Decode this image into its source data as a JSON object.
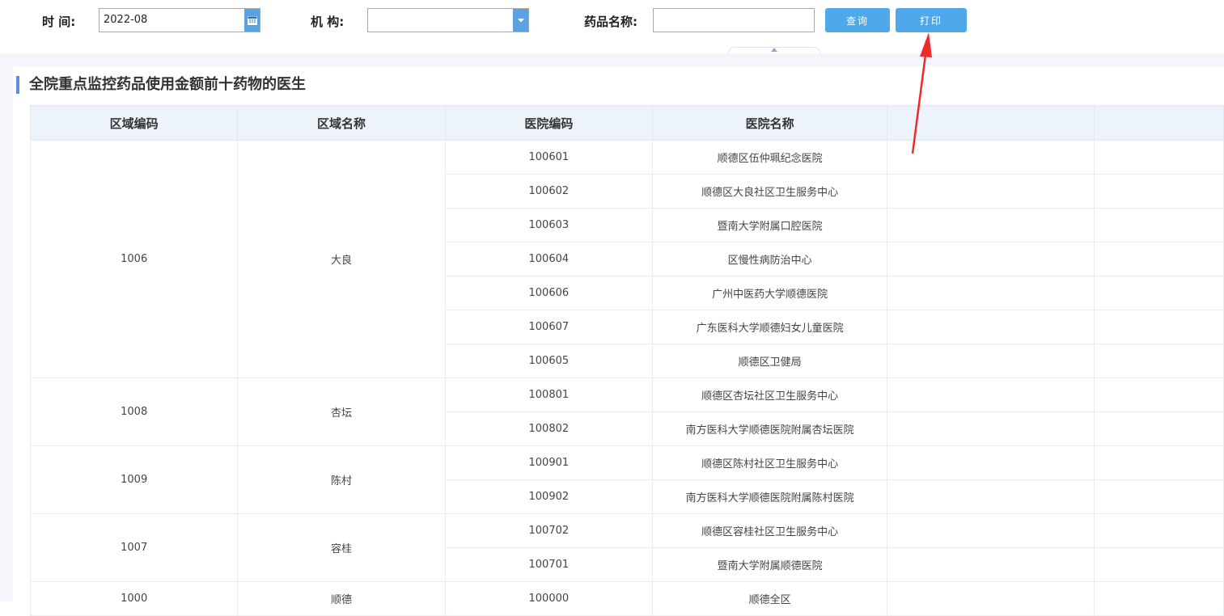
{
  "filters": {
    "time_label": "时 间:",
    "time_value": "2022-08",
    "org_label": "机 构:",
    "org_value": "",
    "drug_label": "药品名称:",
    "drug_value": "",
    "query_button": "查询",
    "print_button": "打印"
  },
  "section": {
    "title": "全院重点监控药品使用金额前十药物的医生"
  },
  "table": {
    "headers": [
      "区域编码",
      "区域名称",
      "医院编码",
      "医院名称",
      "",
      ""
    ],
    "groups": [
      {
        "area_code": "1006",
        "area_name": "大良",
        "hospitals": [
          {
            "code": "100601",
            "name": "顺德区伍仲珮纪念医院"
          },
          {
            "code": "100602",
            "name": "顺德区大良社区卫生服务中心"
          },
          {
            "code": "100603",
            "name": "暨南大学附属口腔医院"
          },
          {
            "code": "100604",
            "name": "区慢性病防治中心"
          },
          {
            "code": "100606",
            "name": "广州中医药大学顺德医院"
          },
          {
            "code": "100607",
            "name": "广东医科大学顺德妇女儿童医院"
          },
          {
            "code": "100605",
            "name": "顺德区卫健局"
          }
        ]
      },
      {
        "area_code": "1008",
        "area_name": "杏坛",
        "hospitals": [
          {
            "code": "100801",
            "name": "顺德区杏坛社区卫生服务中心"
          },
          {
            "code": "100802",
            "name": "南方医科大学顺德医院附属杏坛医院"
          }
        ]
      },
      {
        "area_code": "1009",
        "area_name": "陈村",
        "hospitals": [
          {
            "code": "100901",
            "name": "顺德区陈村社区卫生服务中心"
          },
          {
            "code": "100902",
            "name": "南方医科大学顺德医院附属陈村医院"
          }
        ]
      },
      {
        "area_code": "1007",
        "area_name": "容桂",
        "hospitals": [
          {
            "code": "100702",
            "name": "顺德区容桂社区卫生服务中心"
          },
          {
            "code": "100701",
            "name": "暨南大学附属顺德医院"
          }
        ]
      },
      {
        "area_code": "1000",
        "area_name": "顺德",
        "hospitals": [
          {
            "code": "100000",
            "name": "顺德全区"
          }
        ]
      }
    ]
  },
  "colors": {
    "accent": "#4ea8ea",
    "header_bg": "#edf3fb",
    "annotation_arrow": "#f02a2a"
  },
  "icons": {
    "date_picker": "calendar-icon",
    "dropdown": "chevron-down-icon"
  }
}
